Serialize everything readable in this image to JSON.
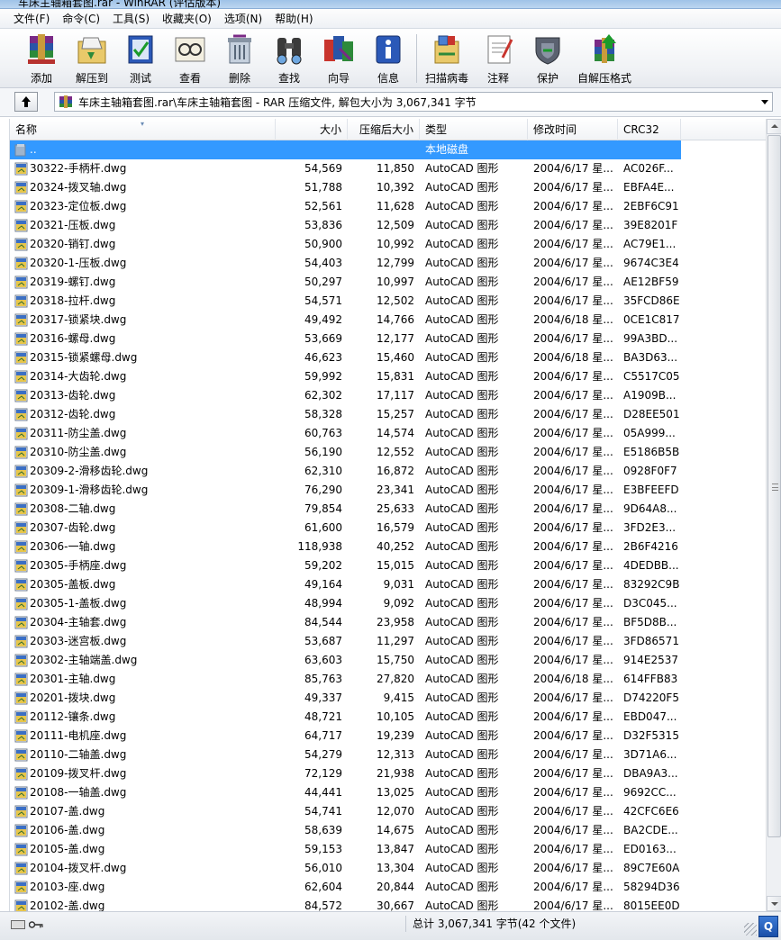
{
  "window": {
    "title": "车床主轴箱套图.rar - WinRAR (评估版本)"
  },
  "menu": [
    "文件(F)",
    "命令(C)",
    "工具(S)",
    "收藏夹(O)",
    "选项(N)",
    "帮助(H)"
  ],
  "toolbar": [
    {
      "label": "添加",
      "icon": "add-archive-icon"
    },
    {
      "label": "解压到",
      "icon": "extract-to-icon"
    },
    {
      "label": "测试",
      "icon": "test-icon"
    },
    {
      "label": "查看",
      "icon": "view-icon"
    },
    {
      "label": "删除",
      "icon": "delete-icon"
    },
    {
      "label": "查找",
      "icon": "find-icon"
    },
    {
      "label": "向导",
      "icon": "wizard-icon"
    },
    {
      "label": "信息",
      "icon": "info-icon"
    },
    {
      "label": "扫描病毒",
      "icon": "virus-scan-icon"
    },
    {
      "label": "注释",
      "icon": "comment-icon"
    },
    {
      "label": "保护",
      "icon": "protect-icon"
    },
    {
      "label": "自解压格式",
      "icon": "sfx-icon"
    }
  ],
  "address": {
    "path": "车床主轴箱套图.rar\\车床主轴箱套图 - RAR 压缩文件, 解包大小为 3,067,341 字节"
  },
  "columns": {
    "name": "名称",
    "size": "大小",
    "packed": "压缩后大小",
    "type": "类型",
    "modified": "修改时间",
    "crc": "CRC32"
  },
  "parent_row": {
    "name": "..",
    "type": "本地磁盘"
  },
  "files": [
    {
      "name": "30322-手柄杆.dwg",
      "size": "54,569",
      "packed": "11,850",
      "type": "AutoCAD 图形",
      "modified": "2004/6/17 星...",
      "crc": "AC026F..."
    },
    {
      "name": "20324-拨叉轴.dwg",
      "size": "51,788",
      "packed": "10,392",
      "type": "AutoCAD 图形",
      "modified": "2004/6/17 星...",
      "crc": "EBFA4E..."
    },
    {
      "name": "20323-定位板.dwg",
      "size": "52,561",
      "packed": "11,628",
      "type": "AutoCAD 图形",
      "modified": "2004/6/17 星...",
      "crc": "2EBF6C91"
    },
    {
      "name": "20321-压板.dwg",
      "size": "53,836",
      "packed": "12,509",
      "type": "AutoCAD 图形",
      "modified": "2004/6/17 星...",
      "crc": "39E8201F"
    },
    {
      "name": "20320-销钉.dwg",
      "size": "50,900",
      "packed": "10,992",
      "type": "AutoCAD 图形",
      "modified": "2004/6/17 星...",
      "crc": "AC79E1..."
    },
    {
      "name": "20320-1-压板.dwg",
      "size": "54,403",
      "packed": "12,799",
      "type": "AutoCAD 图形",
      "modified": "2004/6/17 星...",
      "crc": "9674C3E4"
    },
    {
      "name": "20319-螺钉.dwg",
      "size": "50,297",
      "packed": "10,997",
      "type": "AutoCAD 图形",
      "modified": "2004/6/17 星...",
      "crc": "AE12BF59"
    },
    {
      "name": "20318-拉杆.dwg",
      "size": "54,571",
      "packed": "12,502",
      "type": "AutoCAD 图形",
      "modified": "2004/6/17 星...",
      "crc": "35FCD86E"
    },
    {
      "name": "20317-锁紧块.dwg",
      "size": "49,492",
      "packed": "14,766",
      "type": "AutoCAD 图形",
      "modified": "2004/6/18 星...",
      "crc": "0CE1C817"
    },
    {
      "name": "20316-螺母.dwg",
      "size": "53,669",
      "packed": "12,177",
      "type": "AutoCAD 图形",
      "modified": "2004/6/17 星...",
      "crc": "99A3BD..."
    },
    {
      "name": "20315-锁紧螺母.dwg",
      "size": "46,623",
      "packed": "15,460",
      "type": "AutoCAD 图形",
      "modified": "2004/6/18 星...",
      "crc": "BA3D63..."
    },
    {
      "name": "20314-大齿轮.dwg",
      "size": "59,992",
      "packed": "15,831",
      "type": "AutoCAD 图形",
      "modified": "2004/6/17 星...",
      "crc": "C5517C05"
    },
    {
      "name": "20313-齿轮.dwg",
      "size": "62,302",
      "packed": "17,117",
      "type": "AutoCAD 图形",
      "modified": "2004/6/17 星...",
      "crc": "A1909B..."
    },
    {
      "name": "20312-齿轮.dwg",
      "size": "58,328",
      "packed": "15,257",
      "type": "AutoCAD 图形",
      "modified": "2004/6/17 星...",
      "crc": "D28EE501"
    },
    {
      "name": "20311-防尘盖.dwg",
      "size": "60,763",
      "packed": "14,574",
      "type": "AutoCAD 图形",
      "modified": "2004/6/17 星...",
      "crc": "05A999..."
    },
    {
      "name": "20310-防尘盖.dwg",
      "size": "56,190",
      "packed": "12,552",
      "type": "AutoCAD 图形",
      "modified": "2004/6/17 星...",
      "crc": "E5186B5B"
    },
    {
      "name": "20309-2-滑移齿轮.dwg",
      "size": "62,310",
      "packed": "16,872",
      "type": "AutoCAD 图形",
      "modified": "2004/6/17 星...",
      "crc": "0928F0F7"
    },
    {
      "name": "20309-1-滑移齿轮.dwg",
      "size": "76,290",
      "packed": "23,341",
      "type": "AutoCAD 图形",
      "modified": "2004/6/17 星...",
      "crc": "E3BFEEFD"
    },
    {
      "name": "20308-二轴.dwg",
      "size": "79,854",
      "packed": "25,633",
      "type": "AutoCAD 图形",
      "modified": "2004/6/17 星...",
      "crc": "9D64A8..."
    },
    {
      "name": "20307-齿轮.dwg",
      "size": "61,600",
      "packed": "16,579",
      "type": "AutoCAD 图形",
      "modified": "2004/6/17 星...",
      "crc": "3FD2E3..."
    },
    {
      "name": "20306-一轴.dwg",
      "size": "118,938",
      "packed": "40,252",
      "type": "AutoCAD 图形",
      "modified": "2004/6/17 星...",
      "crc": "2B6F4216"
    },
    {
      "name": "20305-手柄座.dwg",
      "size": "59,202",
      "packed": "15,015",
      "type": "AutoCAD 图形",
      "modified": "2004/6/17 星...",
      "crc": "4DEDBB..."
    },
    {
      "name": "20305-盖板.dwg",
      "size": "49,164",
      "packed": "9,031",
      "type": "AutoCAD 图形",
      "modified": "2004/6/17 星...",
      "crc": "83292C9B"
    },
    {
      "name": "20305-1-盖板.dwg",
      "size": "48,994",
      "packed": "9,092",
      "type": "AutoCAD 图形",
      "modified": "2004/6/17 星...",
      "crc": "D3C045..."
    },
    {
      "name": "20304-主轴套.dwg",
      "size": "84,544",
      "packed": "23,958",
      "type": "AutoCAD 图形",
      "modified": "2004/6/17 星...",
      "crc": "BF5D8B..."
    },
    {
      "name": "20303-迷宫板.dwg",
      "size": "53,687",
      "packed": "11,297",
      "type": "AutoCAD 图形",
      "modified": "2004/6/17 星...",
      "crc": "3FD86571"
    },
    {
      "name": "20302-主轴端盖.dwg",
      "size": "63,603",
      "packed": "15,750",
      "type": "AutoCAD 图形",
      "modified": "2004/6/17 星...",
      "crc": "914E2537"
    },
    {
      "name": "20301-主轴.dwg",
      "size": "85,763",
      "packed": "27,820",
      "type": "AutoCAD 图形",
      "modified": "2004/6/18 星...",
      "crc": "614FFB83"
    },
    {
      "name": "20201-拨块.dwg",
      "size": "49,337",
      "packed": "9,415",
      "type": "AutoCAD 图形",
      "modified": "2004/6/17 星...",
      "crc": "D74220F5"
    },
    {
      "name": "20112-镶条.dwg",
      "size": "48,721",
      "packed": "10,105",
      "type": "AutoCAD 图形",
      "modified": "2004/6/17 星...",
      "crc": "EBD047..."
    },
    {
      "name": "20111-电机座.dwg",
      "size": "64,717",
      "packed": "19,239",
      "type": "AutoCAD 图形",
      "modified": "2004/6/17 星...",
      "crc": "D32F5315"
    },
    {
      "name": "20110-二轴盖.dwg",
      "size": "54,279",
      "packed": "12,313",
      "type": "AutoCAD 图形",
      "modified": "2004/6/17 星...",
      "crc": "3D71A6..."
    },
    {
      "name": "20109-拨叉杆.dwg",
      "size": "72,129",
      "packed": "21,938",
      "type": "AutoCAD 图形",
      "modified": "2004/6/17 星...",
      "crc": "DBA9A3..."
    },
    {
      "name": "20108-一轴盖.dwg",
      "size": "44,441",
      "packed": "13,025",
      "type": "AutoCAD 图形",
      "modified": "2004/6/17 星...",
      "crc": "9692CC..."
    },
    {
      "name": "20107-盖.dwg",
      "size": "54,741",
      "packed": "12,070",
      "type": "AutoCAD 图形",
      "modified": "2004/6/17 星...",
      "crc": "42CFC6E6"
    },
    {
      "name": "20106-盖.dwg",
      "size": "58,639",
      "packed": "14,675",
      "type": "AutoCAD 图形",
      "modified": "2004/6/17 星...",
      "crc": "BA2CDE..."
    },
    {
      "name": "20105-盖.dwg",
      "size": "59,153",
      "packed": "13,847",
      "type": "AutoCAD 图形",
      "modified": "2004/6/17 星...",
      "crc": "ED0163..."
    },
    {
      "name": "20104-拨叉杆.dwg",
      "size": "56,010",
      "packed": "13,304",
      "type": "AutoCAD 图形",
      "modified": "2004/6/17 星...",
      "crc": "89C7E60A"
    },
    {
      "name": "20103-座.dwg",
      "size": "62,604",
      "packed": "20,844",
      "type": "AutoCAD 图形",
      "modified": "2004/6/17 星...",
      "crc": "58294D36"
    },
    {
      "name": "20102-盖.dwg",
      "size": "84,572",
      "packed": "30,667",
      "type": "AutoCAD 图形",
      "modified": "2004/6/17 星...",
      "crc": "8015EE0D"
    }
  ],
  "status": {
    "total": "总计 3,067,341 字节(42 个文件)"
  },
  "colors": {
    "selection": "#3399ff",
    "file_icon": "#e8c64a"
  }
}
